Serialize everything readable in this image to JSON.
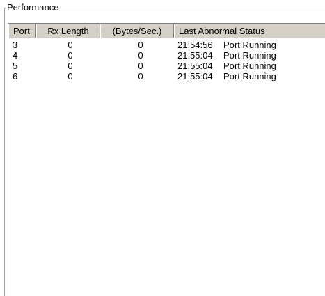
{
  "group": {
    "title": "Performance"
  },
  "table": {
    "columns": [
      "Port",
      "Rx Length",
      "(Bytes/Sec.)",
      "Last Abnormal Status"
    ],
    "rows": [
      {
        "port": "3",
        "rx_length": "0",
        "bytes_per_sec": "0",
        "time": "21:54:56",
        "status": "Port Running"
      },
      {
        "port": "4",
        "rx_length": "0",
        "bytes_per_sec": "0",
        "time": "21:55:04",
        "status": "Port Running"
      },
      {
        "port": "5",
        "rx_length": "0",
        "bytes_per_sec": "0",
        "time": "21:55:04",
        "status": "Port Running"
      },
      {
        "port": "6",
        "rx_length": "0",
        "bytes_per_sec": "0",
        "time": "21:55:04",
        "status": "Port Running"
      }
    ]
  }
}
